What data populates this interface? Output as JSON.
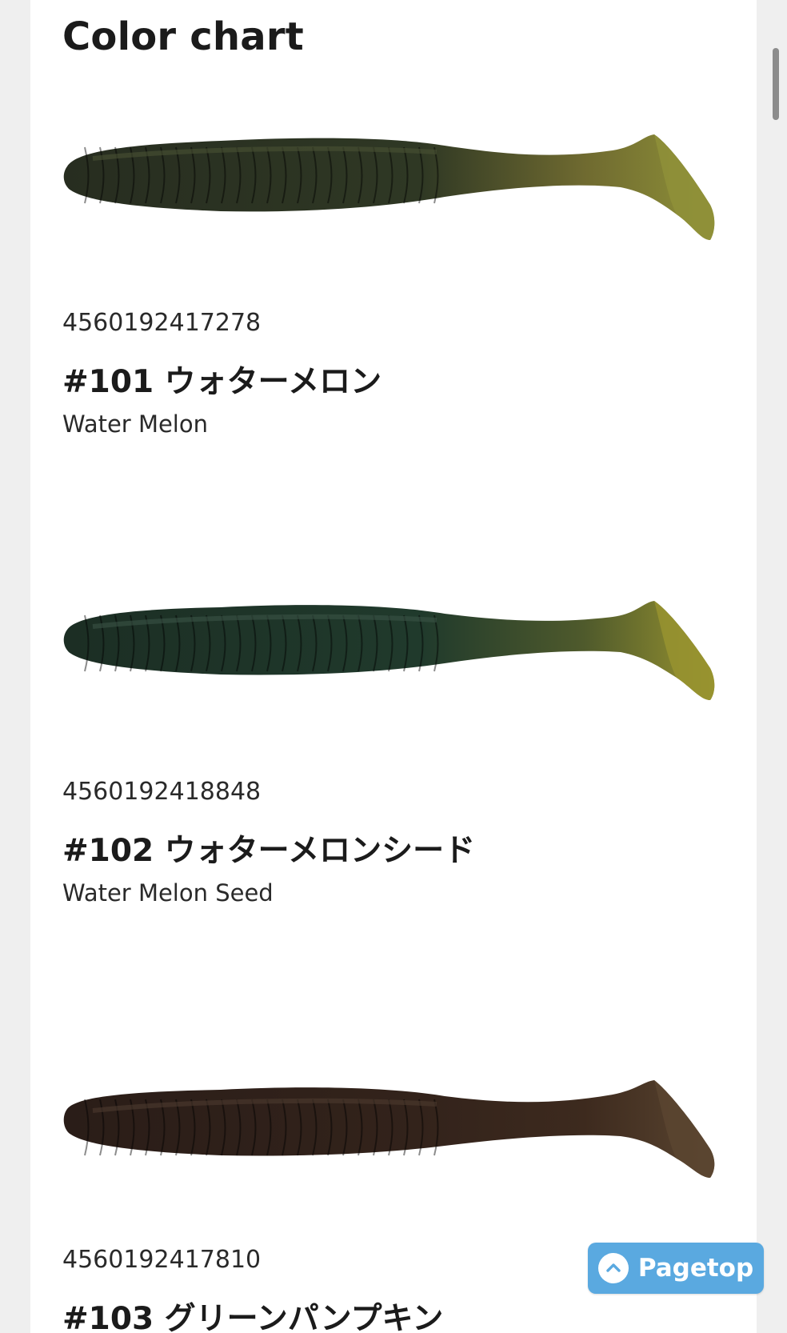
{
  "page": {
    "heading": "Color chart"
  },
  "items": [
    {
      "jan": "4560192417278",
      "name": "#101 ウォターメロン",
      "english": "Water Melon",
      "colors": {
        "head": "#272d20",
        "body": "#2f3824",
        "tail": "#6f6a30",
        "fin": "#8f9138",
        "highlight": "#4a5234"
      }
    },
    {
      "jan": "4560192418848",
      "name": "#102 ウォターメロンシード",
      "english": "Water Melon Seed",
      "colors": {
        "head": "#1c2e24",
        "body": "#203a2c",
        "tail": "#4f5a2c",
        "fin": "#98932f",
        "highlight": "#3b5446"
      }
    },
    {
      "jan": "4560192417810",
      "name": "#103 グリーンパンプキン",
      "english": "",
      "colors": {
        "head": "#2a1d18",
        "body": "#33231b",
        "tail": "#3d2a1e",
        "fin": "#5a4530",
        "highlight": "#4c3a2e"
      }
    }
  ],
  "pagetop": {
    "label": "Pagetop",
    "icon": "chevron-up-circle-icon",
    "color": "#5aa9e0"
  }
}
